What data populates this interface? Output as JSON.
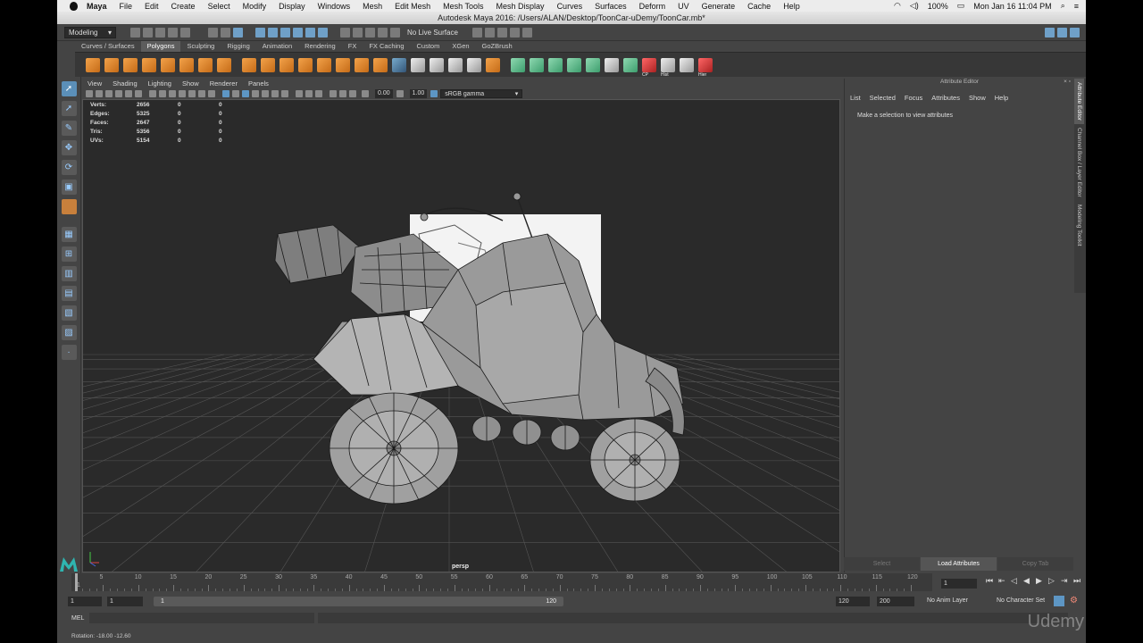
{
  "os_menubar": {
    "app_name": "Maya",
    "items": [
      "File",
      "Edit",
      "Create",
      "Select",
      "Modify",
      "Display",
      "Windows",
      "Mesh",
      "Edit Mesh",
      "Mesh Tools",
      "Mesh Display",
      "Curves",
      "Surfaces",
      "Deform",
      "UV",
      "Generate",
      "Cache",
      "Help"
    ],
    "battery": "100%",
    "clock": "Mon Jan 16  11:04 PM"
  },
  "window_title": "Autodesk Maya 2016: /Users/ALAN/Desktop/ToonCar-uDemy/ToonCar.mb*",
  "status_line": {
    "menu_set": "Modeling",
    "live_surface": "No Live Surface"
  },
  "shelf": {
    "tabs": [
      "Curves / Surfaces",
      "Polygons",
      "Sculpting",
      "Rigging",
      "Animation",
      "Rendering",
      "FX",
      "FX Caching",
      "Custom",
      "XGen",
      "GoZBrush"
    ],
    "active_tab": "Polygons",
    "icon_labels": [
      "CP",
      "Hist",
      "Hier"
    ]
  },
  "viewport": {
    "menu": [
      "View",
      "Shading",
      "Lighting",
      "Show",
      "Renderer",
      "Panels"
    ],
    "exposure": "0.00",
    "gamma": "1.00",
    "color_space": "sRGB gamma",
    "camera": "persp",
    "hud": [
      {
        "label": "Verts:",
        "v1": "2656",
        "v2": "0",
        "v3": "0"
      },
      {
        "label": "Edges:",
        "v1": "5325",
        "v2": "0",
        "v3": "0"
      },
      {
        "label": "Faces:",
        "v1": "2647",
        "v2": "0",
        "v3": "0"
      },
      {
        "label": "Tris:",
        "v1": "5356",
        "v2": "0",
        "v3": "0"
      },
      {
        "label": "UVs:",
        "v1": "5154",
        "v2": "0",
        "v3": "0"
      }
    ]
  },
  "attribute_editor": {
    "title": "Attribute Editor",
    "menu": [
      "List",
      "Selected",
      "Focus",
      "Attributes",
      "Show",
      "Help"
    ],
    "message": "Make a selection to view attributes",
    "buttons": [
      "Select",
      "Load Attributes",
      "Copy Tab"
    ],
    "side_tabs": [
      "Attribute Editor",
      "Channel Box / Layer Editor",
      "Modeling Toolkit"
    ]
  },
  "timeline": {
    "ticks": [
      "5",
      "10",
      "15",
      "20",
      "25",
      "30",
      "35",
      "40",
      "45",
      "50",
      "55",
      "60",
      "65",
      "70",
      "75",
      "80",
      "85",
      "90",
      "95",
      "100",
      "105",
      "110",
      "115",
      "120"
    ],
    "first_tick": "1",
    "current_frame": "1"
  },
  "range_slider": {
    "start": "1",
    "playback_start": "1",
    "bar_start": "1",
    "bar_end": "120",
    "playback_end": "120",
    "end": "200",
    "anim_layer": "No Anim Layer",
    "character_set": "No Character Set"
  },
  "command_line": {
    "language": "MEL"
  },
  "help_line": {
    "text": "Rotation:   -18.00     -12.60"
  },
  "watermark": "Udemy"
}
